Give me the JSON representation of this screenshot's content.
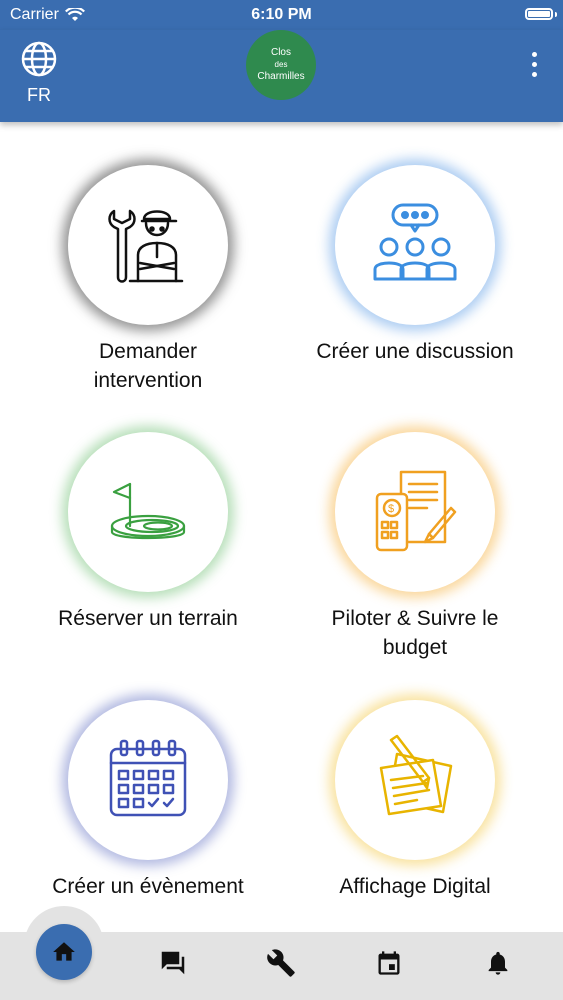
{
  "status_bar": {
    "carrier": "Carrier",
    "time": "6:10 PM"
  },
  "header": {
    "language": "FR",
    "logo": {
      "line1": "Clos",
      "line2": "des",
      "line3": "Charmilles"
    }
  },
  "tiles": [
    {
      "label_line1": "Demander",
      "label_line2": "intervention",
      "icon": "mechanic-icon",
      "color": "#555555"
    },
    {
      "label_line1": "Créer une discussion",
      "label_line2": "",
      "icon": "discussion-group-icon",
      "color": "#4a90e2"
    },
    {
      "label_line1": "Réserver un terrain",
      "label_line2": "",
      "icon": "golf-flag-icon",
      "color": "#4caf50"
    },
    {
      "label_line1": "Piloter & Suivre le",
      "label_line2": "budget",
      "icon": "budget-icon",
      "color": "#f5a623"
    },
    {
      "label_line1": "Créer un évènement",
      "label_line2": "",
      "icon": "calendar-icon",
      "color": "#3f51b5"
    },
    {
      "label_line1": "Affichage Digital",
      "label_line2": "",
      "icon": "notepad-pencil-icon",
      "color": "#f2c12e"
    }
  ],
  "bottom_nav": [
    "home-icon",
    "chat-icon",
    "wrench-icon",
    "calendar-event-icon",
    "bell-icon"
  ],
  "colors": {
    "primary": "#3a6db0",
    "logo_green": "#2f8a4e"
  }
}
